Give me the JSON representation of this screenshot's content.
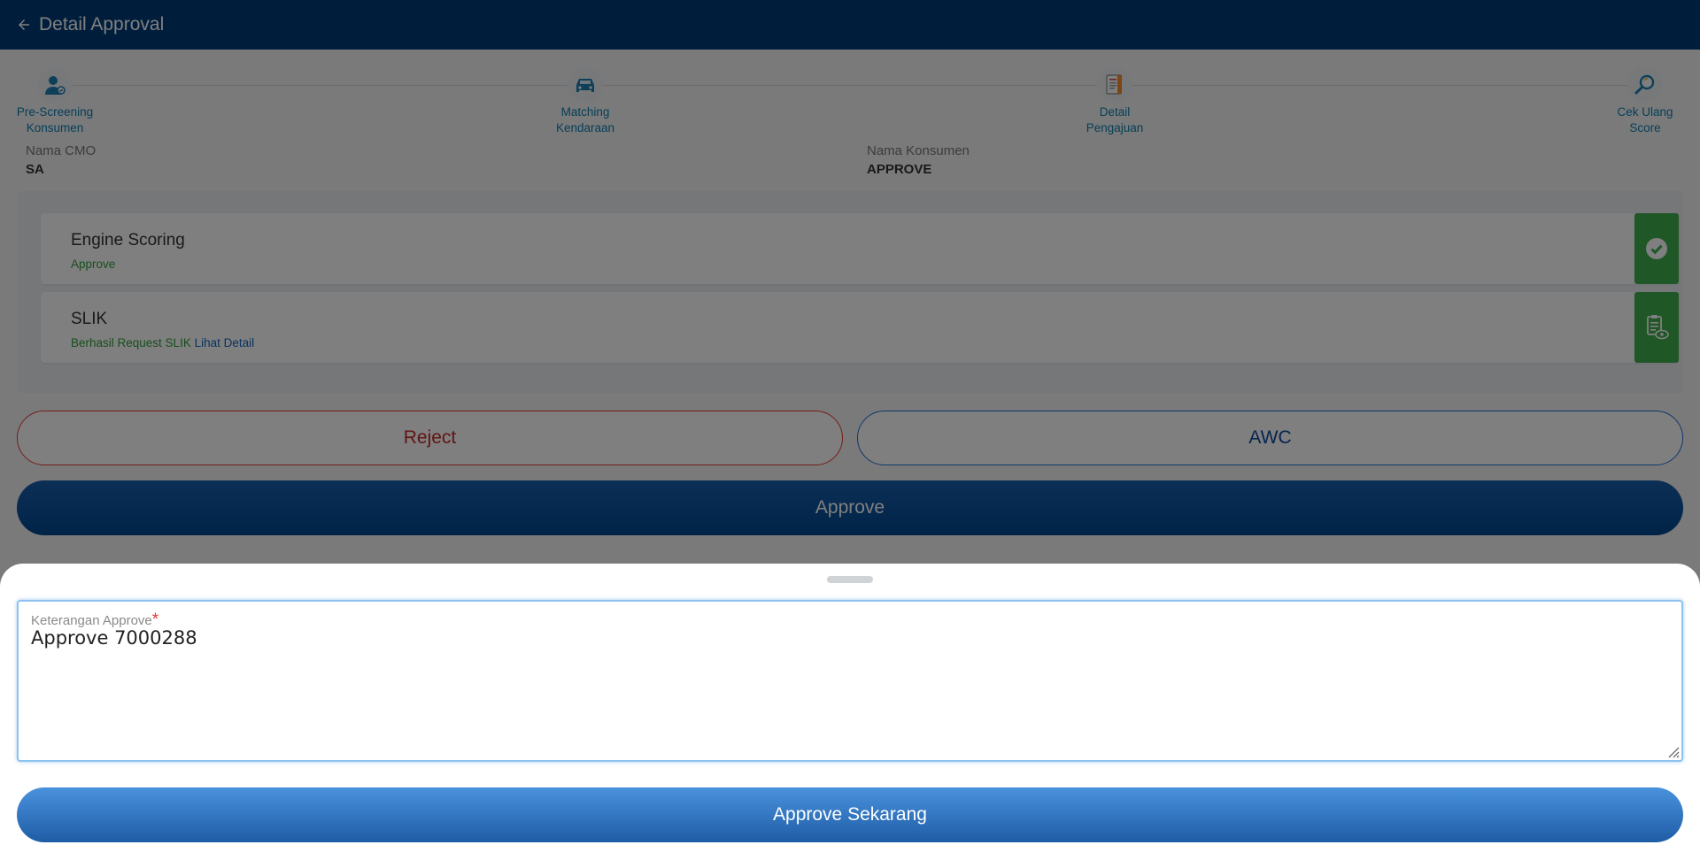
{
  "header": {
    "title": "Detail Approval"
  },
  "steps": [
    {
      "line1": "Pre-Screening",
      "line2": "Konsumen",
      "icon": "user-check-icon"
    },
    {
      "line1": "Matching",
      "line2": "Kendaraan",
      "icon": "car-icon"
    },
    {
      "line1": "Detail",
      "line2": "Pengajuan",
      "icon": "document-icon"
    },
    {
      "line1": "Cek Ulang",
      "line2": "Score",
      "icon": "magnifier-icon"
    }
  ],
  "info": {
    "cmo_label": "Nama CMO",
    "cmo_value": "SA",
    "consumer_label": "Nama Konsumen",
    "consumer_value": "APPROVE"
  },
  "cards": {
    "engine": {
      "title": "Engine Scoring",
      "status": "Approve",
      "icon": "check-circle-icon"
    },
    "slik": {
      "title": "SLIK",
      "status": "Berhasil Request SLIK",
      "link": "Lihat Detail",
      "icon": "document-view-icon"
    }
  },
  "actions": {
    "reject": "Reject",
    "awc": "AWC",
    "approve": "Approve"
  },
  "sheet": {
    "field_label": "Keterangan Approve",
    "required_mark": "*",
    "field_value": "Approve 7000288",
    "submit": "Approve Sekarang"
  },
  "colors": {
    "header": "#003d79",
    "accent_green": "#3fae4e",
    "reject": "#e53935",
    "awc": "#1e6fd0",
    "approve": "#00468f"
  }
}
